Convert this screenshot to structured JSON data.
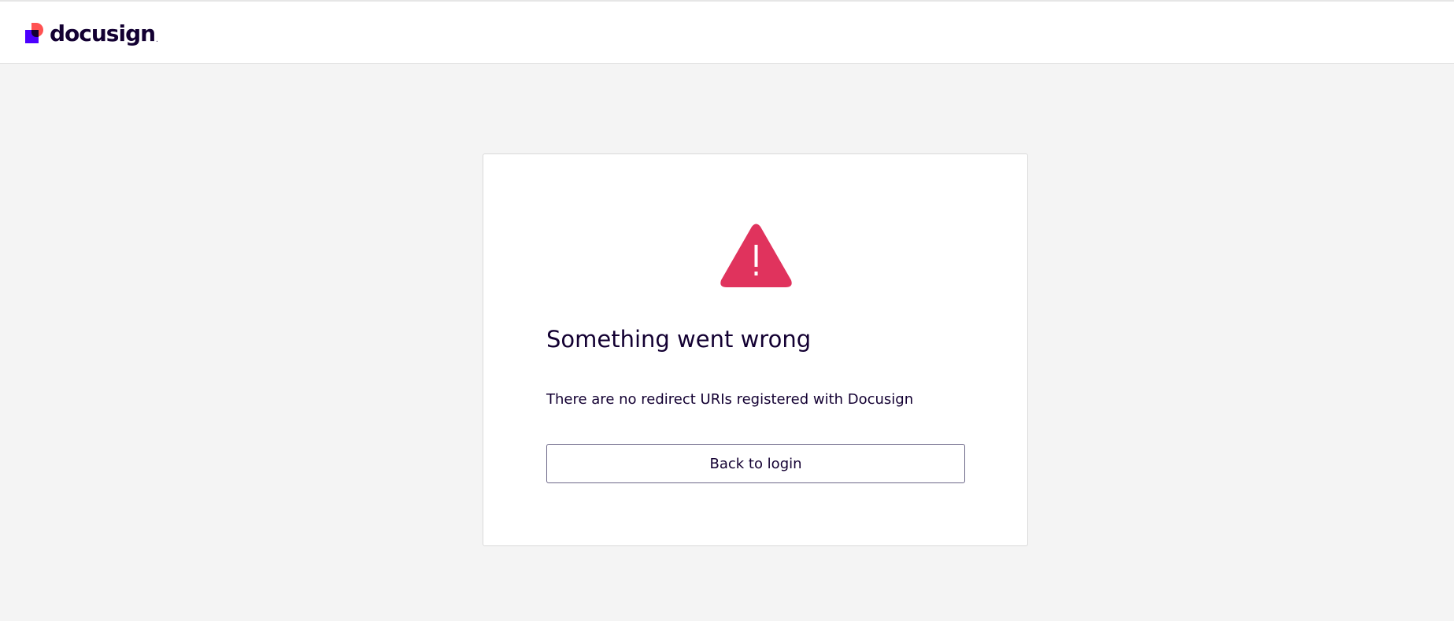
{
  "brand": {
    "name": "docusign",
    "trademark": ".",
    "colors": {
      "primary": "#4c00ff",
      "accent": "#ff5252",
      "dark": "#130032"
    }
  },
  "error_card": {
    "icon": "warning-triangle-icon",
    "icon_color": "#e0335d",
    "title": "Something went wrong",
    "message": "There are no redirect URIs registered with Docusign",
    "button_label": "Back to login"
  }
}
